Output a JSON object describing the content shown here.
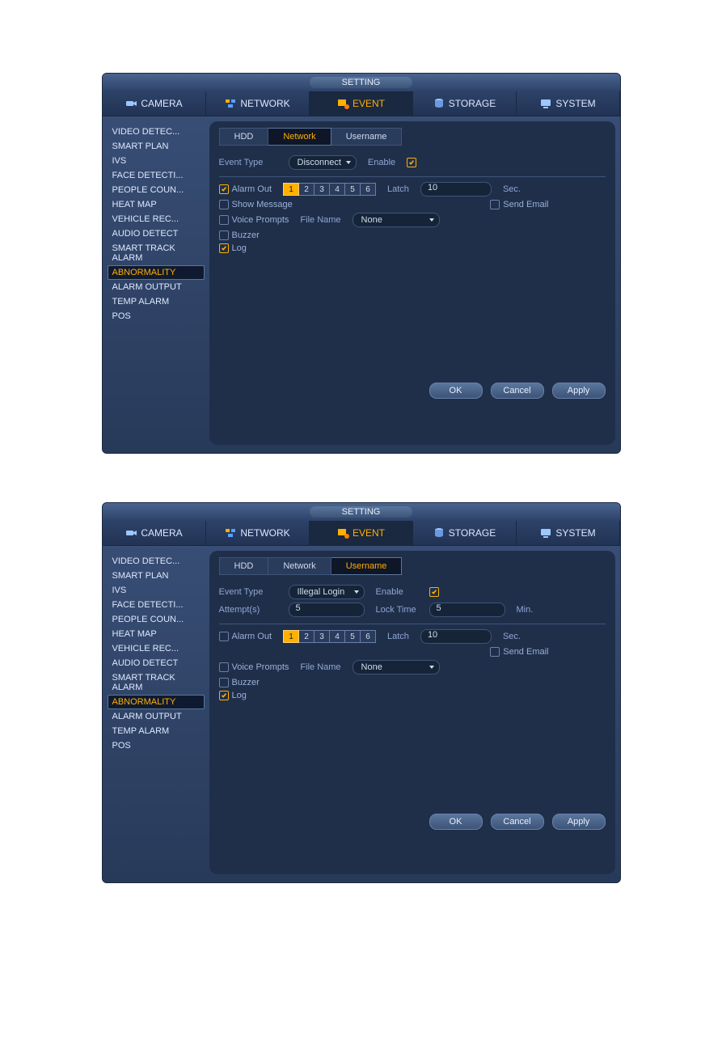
{
  "title": "SETTING",
  "mainTabs": [
    {
      "label": "CAMERA",
      "active": false
    },
    {
      "label": "NETWORK",
      "active": false
    },
    {
      "label": "EVENT",
      "active": true
    },
    {
      "label": "STORAGE",
      "active": false
    },
    {
      "label": "SYSTEM",
      "active": false
    }
  ],
  "sidebar": {
    "items": [
      "VIDEO DETEC...",
      "SMART PLAN",
      "IVS",
      "FACE DETECTI...",
      "PEOPLE COUN...",
      "HEAT MAP",
      "VEHICLE REC...",
      "AUDIO DETECT",
      "SMART TRACK ALARM",
      "ABNORMALITY",
      "ALARM OUTPUT",
      "TEMP ALARM",
      "POS"
    ],
    "activeIndex": 9
  },
  "panel1": {
    "subtabs": [
      "HDD",
      "Network",
      "Username"
    ],
    "activeSubtab": 1,
    "eventTypeLabel": "Event Type",
    "eventTypeValue": "Disconnect",
    "enableLabel": "Enable",
    "enableChecked": true,
    "alarmOut": {
      "label": "Alarm Out",
      "checked": true,
      "channels": [
        "1",
        "2",
        "3",
        "4",
        "5",
        "6"
      ],
      "activeChannel": 0,
      "latchLabel": "Latch",
      "latchValue": "10",
      "latchUnit": "Sec."
    },
    "showMessage": {
      "label": "Show Message",
      "checked": false
    },
    "sendEmail": {
      "label": "Send Email",
      "checked": false
    },
    "voicePrompts": {
      "label": "Voice Prompts",
      "checked": false,
      "fileNameLabel": "File Name",
      "fileNameValue": "None"
    },
    "buzzer": {
      "label": "Buzzer",
      "checked": false
    },
    "log": {
      "label": "Log",
      "checked": true
    },
    "buttons": {
      "ok": "OK",
      "cancel": "Cancel",
      "apply": "Apply"
    }
  },
  "panel2": {
    "subtabs": [
      "HDD",
      "Network",
      "Username"
    ],
    "activeSubtab": 2,
    "eventTypeLabel": "Event Type",
    "eventTypeValue": "Illegal Login",
    "enableLabel": "Enable",
    "enableChecked": true,
    "attemptsLabel": "Attempt(s)",
    "attemptsValue": "5",
    "lockTimeLabel": "Lock Time",
    "lockTimeValue": "5",
    "lockTimeUnit": "Min.",
    "alarmOut": {
      "label": "Alarm Out",
      "checked": false,
      "channels": [
        "1",
        "2",
        "3",
        "4",
        "5",
        "6"
      ],
      "activeChannel": 0,
      "latchLabel": "Latch",
      "latchValue": "10",
      "latchUnit": "Sec."
    },
    "sendEmail": {
      "label": "Send Email",
      "checked": false
    },
    "voicePrompts": {
      "label": "Voice Prompts",
      "checked": false,
      "fileNameLabel": "File Name",
      "fileNameValue": "None"
    },
    "buzzer": {
      "label": "Buzzer",
      "checked": false
    },
    "log": {
      "label": "Log",
      "checked": true
    },
    "buttons": {
      "ok": "OK",
      "cancel": "Cancel",
      "apply": "Apply"
    }
  }
}
